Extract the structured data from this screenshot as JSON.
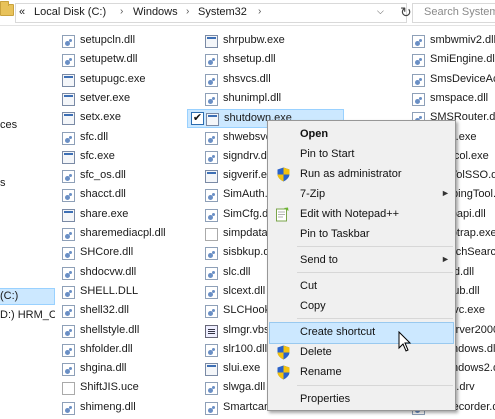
{
  "address_bar": {
    "overflow": "«",
    "crumbs": [
      "Local Disk (C:)",
      "Windows",
      "System32"
    ],
    "separator": "›",
    "dropdown": "⌵",
    "refresh": "↻",
    "search_placeholder": "Search System32"
  },
  "nav": {
    "items": [
      "ces",
      "s",
      "(C:)",
      "D:) HRM_C"
    ],
    "selected_index": 2
  },
  "files": {
    "col1": [
      {
        "name": "setupcln.dll",
        "type": "dll"
      },
      {
        "name": "setupetw.dll",
        "type": "dll"
      },
      {
        "name": "setupugc.exe",
        "type": "exe"
      },
      {
        "name": "setver.exe",
        "type": "exe"
      },
      {
        "name": "setx.exe",
        "type": "exe"
      },
      {
        "name": "sfc.dll",
        "type": "dll"
      },
      {
        "name": "sfc.exe",
        "type": "exe"
      },
      {
        "name": "sfc_os.dll",
        "type": "dll"
      },
      {
        "name": "shacct.dll",
        "type": "dll"
      },
      {
        "name": "share.exe",
        "type": "exe"
      },
      {
        "name": "sharemediacpl.dll",
        "type": "dll"
      },
      {
        "name": "SHCore.dll",
        "type": "dll"
      },
      {
        "name": "shdocvw.dll",
        "type": "dll"
      },
      {
        "name": "SHELL.DLL",
        "type": "dll"
      },
      {
        "name": "shell32.dll",
        "type": "dll"
      },
      {
        "name": "shellstyle.dll",
        "type": "dll"
      },
      {
        "name": "shfolder.dll",
        "type": "dll"
      },
      {
        "name": "shgina.dll",
        "type": "dll"
      },
      {
        "name": "ShiftJIS.uce",
        "type": "ucse"
      },
      {
        "name": "shimeng.dll",
        "type": "dll"
      }
    ],
    "col2": [
      {
        "name": "shrpubw.exe",
        "type": "exe"
      },
      {
        "name": "shsetup.dll",
        "type": "dll"
      },
      {
        "name": "shsvcs.dll",
        "type": "dll"
      },
      {
        "name": "shunimpl.dll",
        "type": "dll"
      },
      {
        "name": "shutdown.exe",
        "type": "exe",
        "selected": true
      },
      {
        "name": "shwebsvc.dll",
        "type": "dll"
      },
      {
        "name": "signdrv.dll",
        "type": "dll"
      },
      {
        "name": "sigverif.exe",
        "type": "exe"
      },
      {
        "name": "SimAuth.dll",
        "type": "dll"
      },
      {
        "name": "SimCfg.dll",
        "type": "dll"
      },
      {
        "name": "simpdata.tlb",
        "type": "ucse"
      },
      {
        "name": "sisbkup.dll",
        "type": "dll"
      },
      {
        "name": "slc.dll",
        "type": "dll"
      },
      {
        "name": "slcext.dll",
        "type": "dll"
      },
      {
        "name": "SLCHook.dll",
        "type": "dll"
      },
      {
        "name": "slmgr.vbs",
        "type": "vbs"
      },
      {
        "name": "slr100.dll",
        "type": "dll"
      },
      {
        "name": "slui.exe",
        "type": "exe"
      },
      {
        "name": "slwga.dll",
        "type": "dll"
      },
      {
        "name": "Smartcard.dll",
        "type": "dll"
      }
    ],
    "col3": [
      {
        "name": "smbwmiv2.dll",
        "type": "dll"
      },
      {
        "name": "SmiEngine.dll",
        "type": "dll"
      },
      {
        "name": "SmsDeviceAccess.dll",
        "type": "dll"
      },
      {
        "name": "smspace.dll",
        "type": "dll"
      },
      {
        "name": "SMSRouter.dll",
        "type": "dll"
      },
      {
        "name": "smss.exe",
        "type": "exe"
      },
      {
        "name": "smtpcol.exe",
        "type": "exe"
      },
      {
        "name": "SndVolSSO.dll",
        "type": "dll"
      },
      {
        "name": "SnippingTool.exe",
        "type": "exe"
      },
      {
        "name": "snmpapi.dll",
        "type": "dll"
      },
      {
        "name": "snmptrap.exe",
        "type": "exe"
      },
      {
        "name": "SpeechSearch.dll",
        "type": "dll"
      },
      {
        "name": "spbod.dll",
        "type": "dll"
      },
      {
        "name": "spnsub.dll",
        "type": "dll"
      },
      {
        "name": "sppsvc.exe",
        "type": "exe"
      },
      {
        "name": "sqlserver2000.dll",
        "type": "dll"
      },
      {
        "name": "srWindows.dll",
        "type": "dll"
      },
      {
        "name": "srWindows2.dll",
        "type": "dll"
      },
      {
        "name": "sstpd.drv",
        "type": "dll"
      },
      {
        "name": "stdRecorder.dll",
        "type": "dll"
      }
    ]
  },
  "context_menu": {
    "items": [
      {
        "label": "Open",
        "bold": true
      },
      {
        "label": "Pin to Start"
      },
      {
        "label": "Run as administrator",
        "icon": "shield-icon"
      },
      {
        "label": "7-Zip",
        "submenu": true
      },
      {
        "label": "Edit with Notepad++",
        "icon": "notepad-plus-plus-icon"
      },
      {
        "label": "Pin to Taskbar"
      },
      {
        "label": "Send to",
        "submenu": true
      },
      {
        "label": "Cut"
      },
      {
        "label": "Copy"
      },
      {
        "label": "Create shortcut",
        "highlighted": true
      },
      {
        "label": "Delete",
        "icon": "shield-icon"
      },
      {
        "label": "Rename",
        "icon": "shield-icon"
      },
      {
        "label": "Properties"
      }
    ],
    "submenu_arrow": "►"
  },
  "colors": {
    "selection": "#cce8ff",
    "selection_border": "#99d1ff",
    "menu_bg": "#f0f0f0",
    "shield_blue": "#2a62c9",
    "shield_yellow": "#f4c20d"
  }
}
